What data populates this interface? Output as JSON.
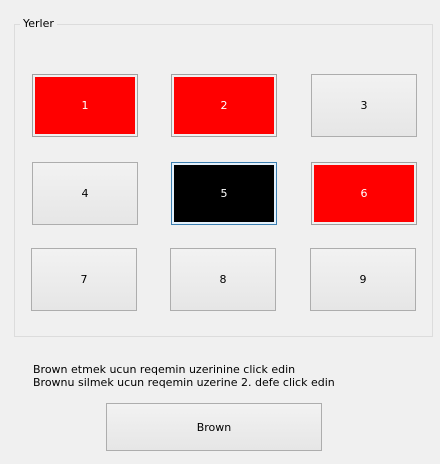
{
  "group": {
    "title": "Yerler"
  },
  "seats": [
    {
      "label": "1",
      "state": "red"
    },
    {
      "label": "2",
      "state": "red"
    },
    {
      "label": "3",
      "state": "default"
    },
    {
      "label": "4",
      "state": "default"
    },
    {
      "label": "5",
      "state": "black"
    },
    {
      "label": "6",
      "state": "red"
    },
    {
      "label": "7",
      "state": "default"
    },
    {
      "label": "8",
      "state": "default"
    },
    {
      "label": "9",
      "state": "default"
    }
  ],
  "instructions": {
    "line1": "Brown etmek ucun reqemin uzerinine click edin",
    "line2": "Brownu silmek ucun reqemin uzerine 2. defe click edin"
  },
  "actions": {
    "brown_label": "Brown"
  },
  "colors": {
    "reserved": "#ff0000",
    "selected": "#000000",
    "window_bg": "#f0f0f0"
  }
}
